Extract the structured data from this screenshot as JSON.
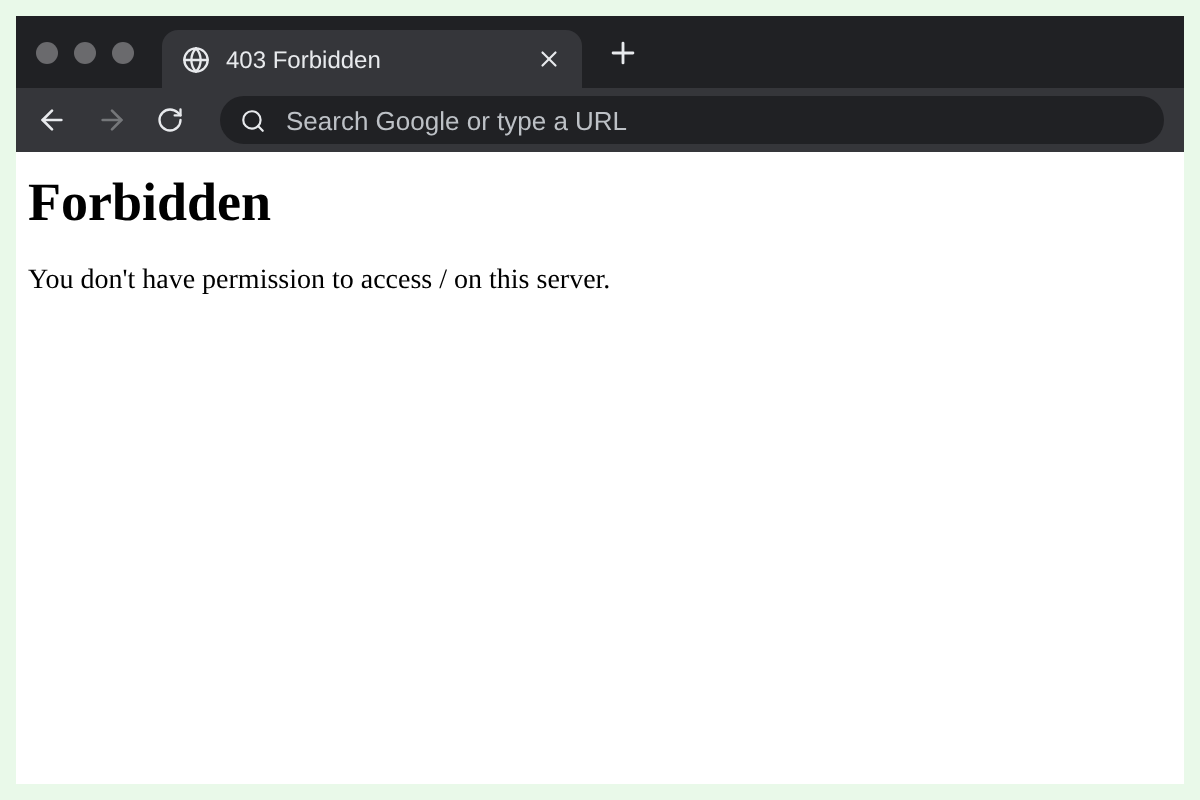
{
  "tabs": [
    {
      "title": "403 Forbidden",
      "selected": true
    }
  ],
  "nav": [
    {
      "kind": "back",
      "disabled": false
    },
    {
      "kind": "forward",
      "disabled": true
    },
    {
      "kind": "reload",
      "disabled": false
    }
  ],
  "address_bar": {
    "placeholder": "Search Google or type a URL"
  },
  "page": {
    "heading": "Forbidden",
    "message": "You don't have permission to access / on this server."
  }
}
